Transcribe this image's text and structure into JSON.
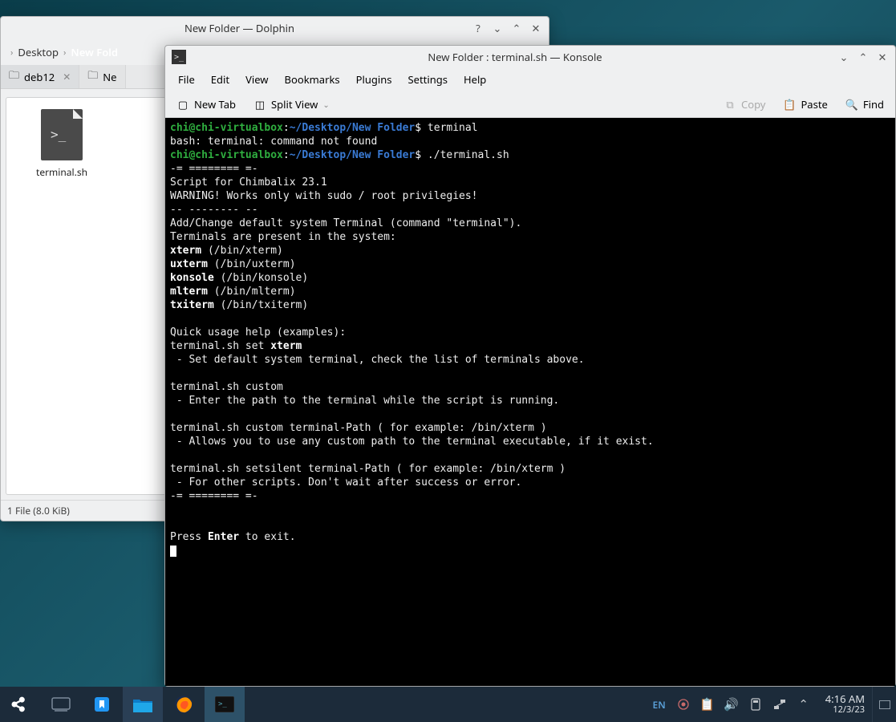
{
  "dolphin": {
    "title": "New Folder — Dolphin",
    "breadcrumb": {
      "parent": "Desktop",
      "current": "New Fold"
    },
    "tabs": [
      {
        "label": "deb12"
      },
      {
        "label": "Ne"
      }
    ],
    "file": {
      "name": "terminal.sh"
    },
    "status": "1 File (8.0 KiB)"
  },
  "konsole": {
    "title": "New Folder : terminal.sh — Konsole",
    "menu": {
      "file": "File",
      "edit": "Edit",
      "view": "View",
      "bookmarks": "Bookmarks",
      "plugins": "Plugins",
      "settings": "Settings",
      "help": "Help"
    },
    "toolbar": {
      "newtab": "New Tab",
      "split": "Split View",
      "copy": "Copy",
      "paste": "Paste",
      "find": "Find"
    },
    "term": {
      "user1": "chi@chi-virtualbox",
      "path1": "~/Desktop/New Folder",
      "cmd1": " terminal",
      "err": "bash: terminal: command not found",
      "user2": "chi@chi-virtualbox",
      "path2": "~/Desktop/New Folder",
      "cmd2": " ./terminal.sh",
      "l1": "-= ======== =-",
      "l2": "Script for Chimbalix 23.1",
      "l3": "WARNING! Works only with sudo / root privilegies!",
      "l4": "-- -------- --",
      "l5": "Add/Change default system Terminal (command \"terminal\").",
      "l6": "Terminals are present in the system:",
      "t1": "xterm",
      "t1p": " (/bin/xterm)",
      "t2": "uxterm",
      "t2p": " (/bin/uxterm)",
      "t3": "konsole",
      "t3p": " (/bin/konsole)",
      "t4": "mlterm",
      "t4p": " (/bin/mlterm)",
      "t5": "txiterm",
      "t5p": " (/bin/txiterm)",
      "q1": "Quick usage help (examples):",
      "q2": "terminal.sh set ",
      "q2b": "xterm",
      "q3": " - Set default system terminal, check the list of terminals above.",
      "q4": "terminal.sh custom",
      "q5": " - Enter the path to the terminal while the script is running.",
      "q6": "terminal.sh custom terminal-Path ( for example: /bin/xterm )",
      "q7": " - Allows you to use any custom path to the terminal executable, if it exist.",
      "q8": "terminal.sh setsilent terminal-Path ( for example: /bin/xterm )",
      "q9": " - For other scripts. Don't wait after success or error.",
      "l7": "-= ======== =-",
      "p1": "Press ",
      "p1b": "Enter",
      "p2": " to exit."
    }
  },
  "taskbar": {
    "lang": "EN",
    "time": "4:16 AM",
    "date": "12/3/23"
  }
}
